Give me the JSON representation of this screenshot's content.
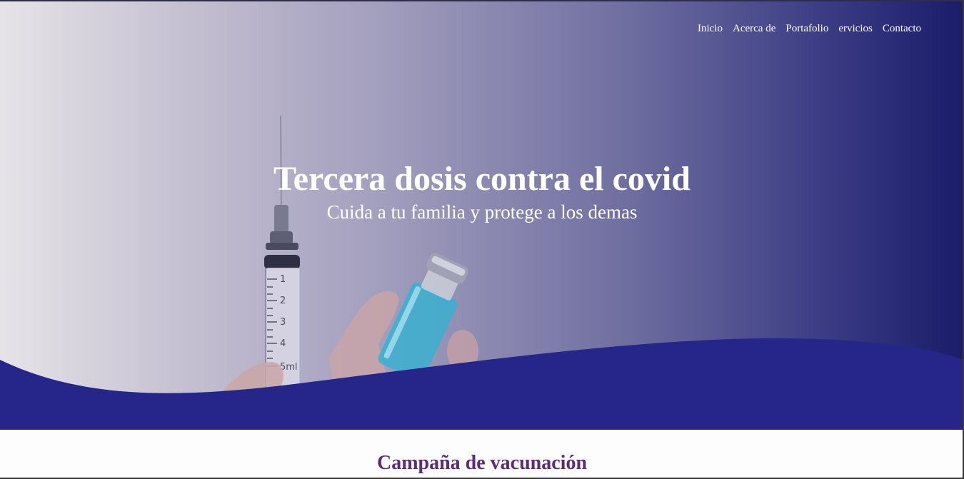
{
  "nav": {
    "items": [
      {
        "label": "Inicio"
      },
      {
        "label": "Acerca de"
      },
      {
        "label": "Portafolio"
      },
      {
        "label": "ervicios"
      },
      {
        "label": "Contacto"
      }
    ]
  },
  "hero": {
    "title": "Tercera dosis contra el covid",
    "subtitle": "Cuida a tu familia y protege a los demas",
    "image": "syringe-and-vaccine-vial-photo",
    "syringe_scale_labels": [
      "1",
      "2",
      "3",
      "4",
      "5ml"
    ],
    "wave_color": "#26268a"
  },
  "section": {
    "title": "Campaña de vacunación",
    "title_color": "#5b2c7a"
  }
}
